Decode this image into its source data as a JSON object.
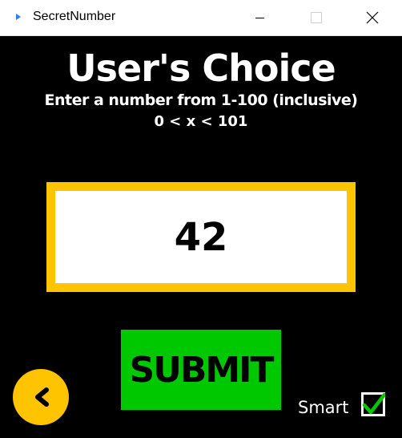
{
  "window": {
    "title": "SecretNumber",
    "controls": {
      "minimize": "minimize-icon",
      "maximize": "maximize-icon",
      "close": "close-icon"
    }
  },
  "main": {
    "heading": "User's Choice",
    "subtitle": "Enter a number from 1-100 (inclusive)",
    "range": "0 < x < 101",
    "number_value": "42",
    "submit_label": "SUBMIT",
    "back_icon": "chevron-left-icon",
    "smart_label": "Smart",
    "smart_checked": true
  },
  "colors": {
    "background": "#000000",
    "accent_yellow": "#ffc400",
    "submit_green": "#00c800",
    "check_green": "#00c800"
  }
}
